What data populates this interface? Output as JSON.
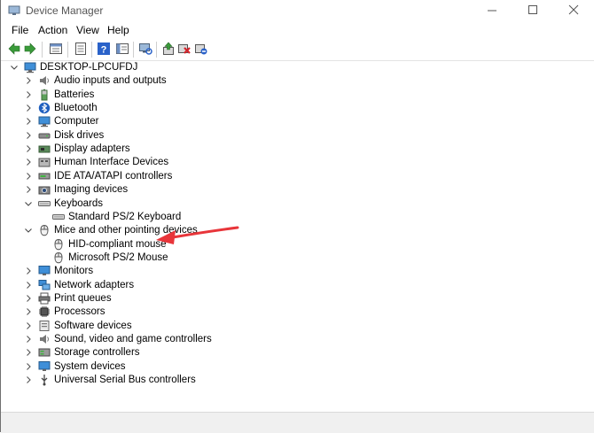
{
  "window": {
    "title": "Device Manager"
  },
  "menu": [
    "File",
    "Action",
    "View",
    "Help"
  ],
  "toolbar": [
    "back-icon",
    "forward-icon",
    "properties-icon",
    "show-hidden-icon",
    "help-icon",
    "show-console-icon",
    "scan-hardware-icon",
    "update-driver-icon",
    "uninstall-icon",
    "disable-icon"
  ],
  "tree": {
    "root": "DESKTOP-LPCUFDJ",
    "items": [
      {
        "label": "Audio inputs and outputs",
        "icon": "speaker-icon",
        "expanded": false
      },
      {
        "label": "Batteries",
        "icon": "battery-icon",
        "expanded": false
      },
      {
        "label": "Bluetooth",
        "icon": "bluetooth-icon",
        "expanded": false
      },
      {
        "label": "Computer",
        "icon": "computer-icon",
        "expanded": false
      },
      {
        "label": "Disk drives",
        "icon": "disk-icon",
        "expanded": false
      },
      {
        "label": "Display adapters",
        "icon": "display-adapter-icon",
        "expanded": false
      },
      {
        "label": "Human Interface Devices",
        "icon": "hid-icon",
        "expanded": false
      },
      {
        "label": "IDE ATA/ATAPI controllers",
        "icon": "ide-icon",
        "expanded": false
      },
      {
        "label": "Imaging devices",
        "icon": "camera-icon",
        "expanded": false
      },
      {
        "label": "Keyboards",
        "icon": "keyboard-icon",
        "expanded": true,
        "children": [
          {
            "label": "Standard PS/2 Keyboard",
            "icon": "keyboard-icon"
          }
        ]
      },
      {
        "label": "Mice and other pointing devices",
        "icon": "mouse-icon",
        "expanded": true,
        "children": [
          {
            "label": "HID-compliant mouse",
            "icon": "mouse-icon"
          },
          {
            "label": "Microsoft PS/2 Mouse",
            "icon": "mouse-icon"
          }
        ]
      },
      {
        "label": "Monitors",
        "icon": "monitor-icon",
        "expanded": false
      },
      {
        "label": "Network adapters",
        "icon": "network-icon",
        "expanded": false
      },
      {
        "label": "Print queues",
        "icon": "printer-icon",
        "expanded": false
      },
      {
        "label": "Processors",
        "icon": "processor-icon",
        "expanded": false
      },
      {
        "label": "Software devices",
        "icon": "software-icon",
        "expanded": false
      },
      {
        "label": "Sound, video and game controllers",
        "icon": "sound-icon",
        "expanded": false
      },
      {
        "label": "Storage controllers",
        "icon": "storage-icon",
        "expanded": false
      },
      {
        "label": "System devices",
        "icon": "system-icon",
        "expanded": false
      },
      {
        "label": "Universal Serial Bus controllers",
        "icon": "usb-icon",
        "expanded": false
      }
    ]
  },
  "colors": {
    "annotation_arrow": "#e8353a",
    "toolbar_blue": "#2a62c9",
    "toolbar_green": "#3a9b3a",
    "disable_red": "#d3232a"
  }
}
